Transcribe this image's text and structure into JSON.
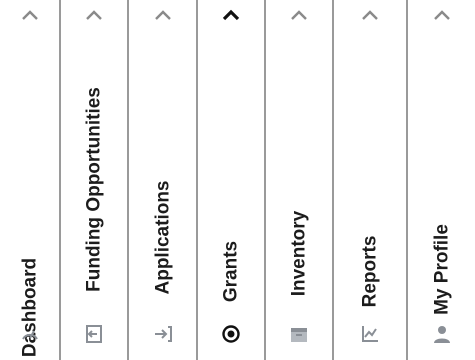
{
  "nav": {
    "items": [
      {
        "label": "Dashboard",
        "icon": "gauge-icon",
        "expanded": false
      },
      {
        "label": "Funding Opportunities",
        "icon": "sign-in-icon",
        "expanded": false
      },
      {
        "label": "Applications",
        "icon": "submit-arrow-icon",
        "expanded": false
      },
      {
        "label": "Grants",
        "icon": "eye-icon",
        "expanded": true
      },
      {
        "label": "Inventory",
        "icon": "box-icon",
        "expanded": false
      },
      {
        "label": "Reports",
        "icon": "report-chart-icon",
        "expanded": false
      },
      {
        "label": "My Profile",
        "icon": "user-icon",
        "expanded": false
      }
    ]
  },
  "colors": {
    "text": "#1c1c1c",
    "chevron_inactive": "#8a8a8a",
    "chevron_active": "#111111",
    "icon": "#8a8f96",
    "divider": "#9a9a9a"
  }
}
